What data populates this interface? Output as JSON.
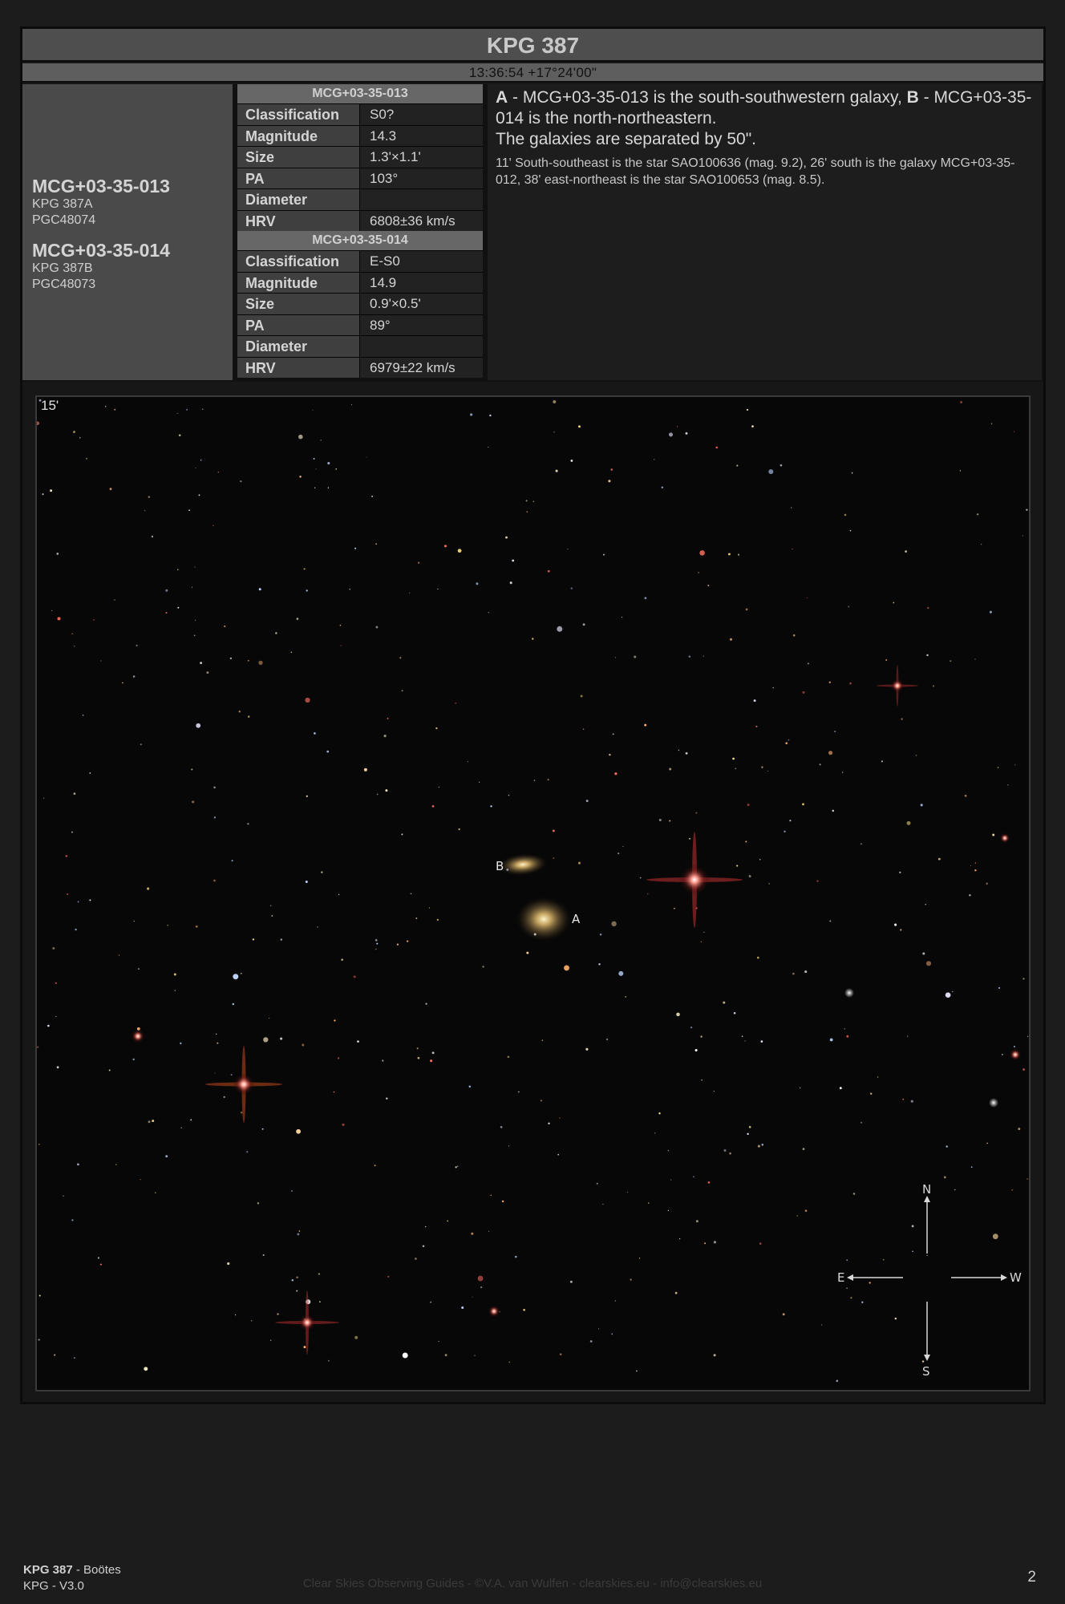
{
  "header": {
    "title": "KPG 387",
    "coordinates": "13:36:54 +17°24'00\""
  },
  "galaxies": [
    {
      "name": "MCG+03-35-013",
      "aliases": [
        "KPG 387A",
        "PGC48074"
      ]
    },
    {
      "name": "MCG+03-35-014",
      "aliases": [
        "KPG 387B",
        "PGC48073"
      ]
    }
  ],
  "properties": [
    {
      "header": "MCG+03-35-013",
      "rows": [
        {
          "label": "Classification",
          "value": "S0?"
        },
        {
          "label": "Magnitude",
          "value": "14.3"
        },
        {
          "label": "Size",
          "value": "1.3'×1.1'"
        },
        {
          "label": "PA",
          "value": "103°"
        },
        {
          "label": "Diameter",
          "value": ""
        },
        {
          "label": "HRV",
          "value": "6808±36 km/s"
        }
      ]
    },
    {
      "header": "MCG+03-35-014",
      "rows": [
        {
          "label": "Classification",
          "value": "E-S0"
        },
        {
          "label": "Magnitude",
          "value": "14.9"
        },
        {
          "label": "Size",
          "value": "0.9'×0.5'"
        },
        {
          "label": "PA",
          "value": "89°"
        },
        {
          "label": "Diameter",
          "value": ""
        },
        {
          "label": "HRV",
          "value": "6979±22 km/s"
        }
      ]
    }
  ],
  "description": {
    "a_letter": "A",
    "a_text": " - MCG+03-35-013 is the south-southwestern galaxy, ",
    "b_letter": "B",
    "b_text": " - MCG+03-35-014 is the north-northeastern.",
    "separation": "The galaxies are separated by 50\".",
    "details": "11' South-southeast is the star SAO100636 (mag. 9.2), 26' south is the galaxy MCG+03-35-012, 38' east-northeast is the star SAO100653 (mag. 8.5)."
  },
  "image": {
    "scale_label": "15'",
    "marker_a": "A",
    "marker_b": "B",
    "compass": {
      "north": "N",
      "south": "S",
      "east": "E",
      "west": "W"
    }
  },
  "footer": {
    "object": "KPG 387",
    "constellation": " - Boötes",
    "version": "KPG - V3.0",
    "credit": "Clear Skies Observing Guides - ©V.A. van Wulfen - clearskies.eu - info@clearskies.eu",
    "page_number": "2"
  }
}
